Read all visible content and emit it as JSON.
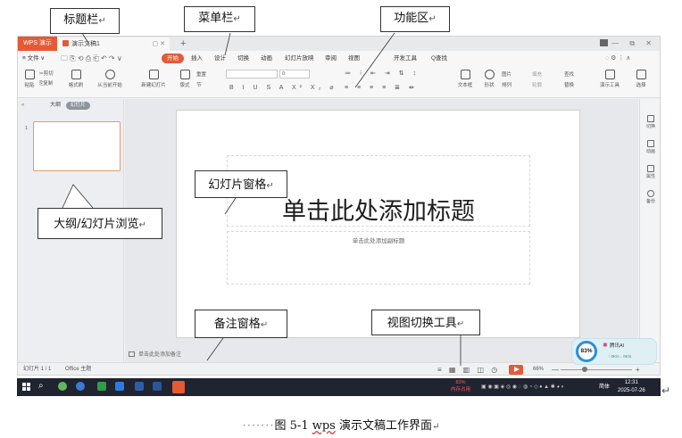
{
  "window": {
    "app_tab": "WPS 演示",
    "doc_tab": "演示文稿1",
    "tab_tools": "▢ ✕",
    "add_tab": "+",
    "window_controls": "— ⧉ ✕"
  },
  "menubar": {
    "file": "≡ 文件 ∨",
    "quick_access": "🗀 ⎘ ⟲ ⎙ ⎗ ↶ ↷ ∨",
    "items": [
      "开始",
      "插入",
      "设计",
      "切换",
      "动画",
      "幻灯片放映",
      "审阅",
      "视图",
      "开发工具",
      "Q查找"
    ],
    "right_icons": "◌ ⚙ ⋮ ∧"
  },
  "ribbon": {
    "paste": "粘贴",
    "cut": "✂剪切",
    "copy": "⎘复制",
    "format_painter": "格式刷",
    "from_start": "从当前开始",
    "new_slide": "新建幻灯片",
    "layout": "版式",
    "reset": "重置",
    "section": "节",
    "font_size": "0",
    "font_buttons": "B I U S A X² X₂ ⌀",
    "align_buttons": "≡ ≡ ≡ ≡ ≣ ⇹",
    "textbox": "文本框",
    "shape": "形状",
    "picture": "图片",
    "arrange": "排列",
    "fill": "填充",
    "outline": "轮廓",
    "find": "查找",
    "replace": "替换",
    "presentation_tools": "演示工具",
    "select": "选择"
  },
  "left_pane": {
    "collapse": "«",
    "tab_outline": "大纲",
    "tab_slides": "幻灯片",
    "slide_number": "1"
  },
  "slide": {
    "title_placeholder": "单击此处添加标题",
    "subtitle_placeholder": "单击此处添加副标题"
  },
  "notes": {
    "placeholder": "单击此处添加备注"
  },
  "right_sidebar": [
    "切换",
    "动画",
    "属性",
    "备份"
  ],
  "statusbar": {
    "slide_count": "幻灯片 1 / 1",
    "theme": "Office 主题",
    "view_icons": "≡ ▦ ▥ ◫ ◷",
    "zoom": "66%",
    "zoom_minus": "—",
    "zoom_plus": "+"
  },
  "ai_widget": {
    "percent": "83%",
    "title": "腾讯AI",
    "stats": "↑ 0K/s   ↓ 0K/s"
  },
  "taskbar": {
    "memory_percent": "83%",
    "memory_label": "内存占用",
    "tray": "▣ ◉ ▣ ◈ ◎ ◉ ◌ ◍ ◔ ◇ ♦ ▲ ✱ ◕ ◐",
    "language": "简体",
    "time": "12:31",
    "date": "2025-07-26"
  },
  "callouts": {
    "title_bar": "标题栏",
    "menu_bar": "菜单栏",
    "function_area": "功能区",
    "slide_pane": "幻灯片窗格",
    "outline_browse": "大纲/幻灯片浏览",
    "notes_pane": "备注窗格",
    "view_switch": "视图切换工具",
    "para_mark": "↵"
  },
  "caption": {
    "dots": "·······",
    "figure_label": "图 5-1 ",
    "wps": "wps",
    "rest": " 演示文稿工作界面",
    "para_mark": "↵"
  },
  "colors": {
    "accent": "#e55a35",
    "taskbar": "#1f2430",
    "ai_ring": "#2b8fd8"
  }
}
